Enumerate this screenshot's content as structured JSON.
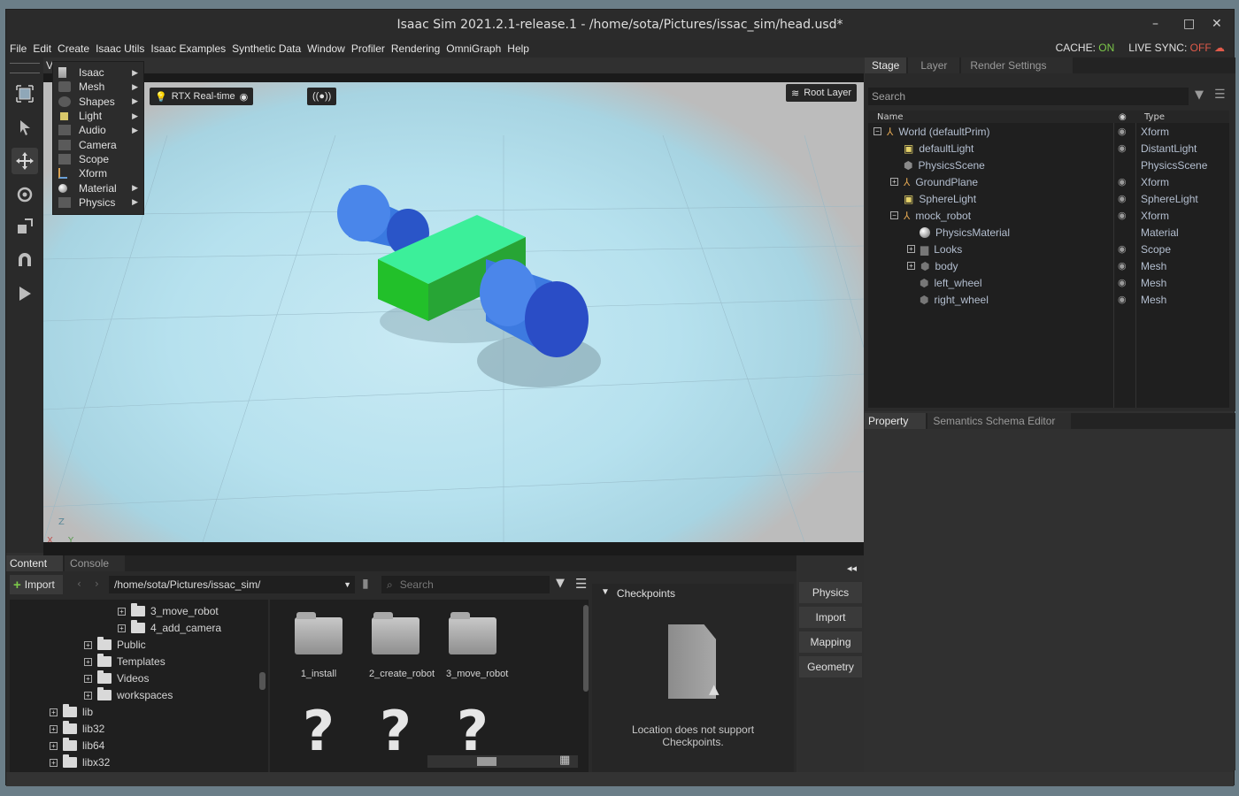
{
  "window": {
    "title": "Isaac Sim 2021.2.1-release.1 - /home/sota/Pictures/issac_sim/head.usd*",
    "minimize": "–",
    "maximize": "□",
    "close": "✕"
  },
  "menubar": {
    "items": [
      "File",
      "Edit",
      "Create",
      "Isaac Utils",
      "Isaac Examples",
      "Synthetic Data",
      "Window",
      "Profiler",
      "Rendering",
      "OmniGraph",
      "Help"
    ],
    "cache_label": "CACHE:",
    "cache_value": "ON",
    "live_sync_label": "LIVE SYNC:",
    "live_sync_value": "OFF"
  },
  "create_menu": {
    "items": [
      {
        "label": "Isaac",
        "has_submenu": true,
        "icon": "robot-arm-icon"
      },
      {
        "label": "Mesh",
        "has_submenu": true,
        "icon": "mesh-icon"
      },
      {
        "label": "Shapes",
        "has_submenu": true,
        "icon": "shapes-icon"
      },
      {
        "label": "Light",
        "has_submenu": true,
        "icon": "light-icon"
      },
      {
        "label": "Audio",
        "has_submenu": true,
        "icon": "audio-icon"
      },
      {
        "label": "Camera",
        "has_submenu": false,
        "icon": "camera-icon"
      },
      {
        "label": "Scope",
        "has_submenu": false,
        "icon": "scope-icon"
      },
      {
        "label": "Xform",
        "has_submenu": false,
        "icon": "xform-icon"
      },
      {
        "label": "Material",
        "has_submenu": true,
        "icon": "material-icon"
      },
      {
        "label": "Physics",
        "has_submenu": true,
        "icon": "physics-icon"
      }
    ],
    "arrow": "▶"
  },
  "viewport": {
    "render_mode": "RTX Real-time",
    "root_layer": "Root Layer",
    "cut_label": "V",
    "axis_z": "Z",
    "axis_x": "X",
    "axis_y": "Y"
  },
  "stage": {
    "tabs": [
      "Stage",
      "Layer",
      "Render Settings"
    ],
    "search_placeholder": "Search",
    "col_name": "Name",
    "col_type": "Type",
    "rows": [
      {
        "name": "World (defaultPrim)",
        "type": "Xform",
        "eye": true
      },
      {
        "name": "defaultLight",
        "type": "DistantLight",
        "eye": true
      },
      {
        "name": "PhysicsScene",
        "type": "PhysicsScene",
        "eye": false
      },
      {
        "name": "GroundPlane",
        "type": "Xform",
        "eye": true
      },
      {
        "name": "SphereLight",
        "type": "SphereLight",
        "eye": true
      },
      {
        "name": "mock_robot",
        "type": "Xform",
        "eye": true
      },
      {
        "name": "PhysicsMaterial",
        "type": "Material",
        "eye": false
      },
      {
        "name": "Looks",
        "type": "Scope",
        "eye": true
      },
      {
        "name": "body",
        "type": "Mesh",
        "eye": true
      },
      {
        "name": "left_wheel",
        "type": "Mesh",
        "eye": true
      },
      {
        "name": "right_wheel",
        "type": "Mesh",
        "eye": true
      }
    ]
  },
  "property": {
    "tabs": [
      "Property",
      "Semantics Schema Editor"
    ]
  },
  "content": {
    "tabs": [
      "Content",
      "Console"
    ],
    "import_label": "Import",
    "path": "/home/sota/Pictures/issac_sim/",
    "search_placeholder": "Search",
    "tree": [
      {
        "label": "3_move_robot",
        "level": 2
      },
      {
        "label": "4_add_camera",
        "level": 2
      },
      {
        "label": "Public",
        "level": 1
      },
      {
        "label": "Templates",
        "level": 1
      },
      {
        "label": "Videos",
        "level": 1
      },
      {
        "label": "workspaces",
        "level": 1
      },
      {
        "label": "lib",
        "level": 0
      },
      {
        "label": "lib32",
        "level": 0
      },
      {
        "label": "lib64",
        "level": 0
      },
      {
        "label": "libx32",
        "level": 0
      }
    ],
    "grid": [
      {
        "label": "1_install"
      },
      {
        "label": "2_create_robot"
      },
      {
        "label": "3_move_robot"
      }
    ],
    "question_mark": "?",
    "checkpoints_title": "Checkpoints",
    "checkpoints_message": "Location does not support Checkpoints."
  },
  "side_buttons": [
    "Physics",
    "Import",
    "Mapping",
    "Geometry"
  ],
  "collapse_icon": "◂◂"
}
